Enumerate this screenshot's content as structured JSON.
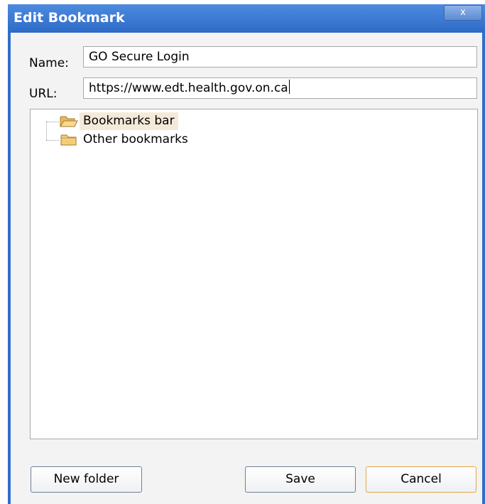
{
  "dialog": {
    "title": "Edit Bookmark",
    "close_label": "x"
  },
  "form": {
    "name_label": "Name:",
    "name_value": "GO Secure Login",
    "url_label": "URL:",
    "url_value": "https://www.edt.health.gov.on.ca"
  },
  "folders": [
    {
      "label": "Bookmarks bar",
      "icon": "folder-open-icon",
      "selected": true
    },
    {
      "label": "Other bookmarks",
      "icon": "folder-icon",
      "selected": false
    }
  ],
  "buttons": {
    "new_folder": "New folder",
    "save": "Save",
    "cancel": "Cancel"
  },
  "colors": {
    "titlebar": "#2d6bc7",
    "folder": "#f5d38a",
    "selection": "#f5ead9",
    "default_button_border": "#e4a64b"
  }
}
